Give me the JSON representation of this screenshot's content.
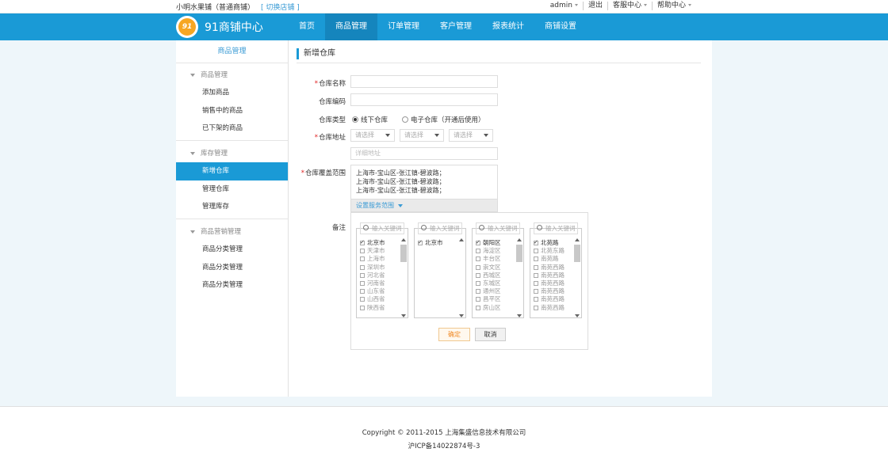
{
  "topbar": {
    "store_name": "小明水果铺（普通商铺）",
    "switch_store": "[ 切换店铺 ]",
    "user": "admin",
    "logout": "退出",
    "service_center": "客服中心",
    "help_center": "帮助中心"
  },
  "header": {
    "logo_text": "91",
    "brand": "91商铺中心",
    "nav": [
      "首页",
      "商品管理",
      "订单管理",
      "客户管理",
      "报表统计",
      "商铺设置"
    ],
    "active_nav": "商品管理"
  },
  "sidebar": {
    "title": "商品管理",
    "groups": [
      {
        "label": "商品管理",
        "items": [
          "添加商品",
          "销售中的商品",
          "已下架的商品"
        ]
      },
      {
        "label": "库存管理",
        "items": [
          "新增仓库",
          "管理仓库",
          "管理库存"
        ]
      },
      {
        "label": "商品营销管理",
        "items": [
          "商品分类管理",
          "商品分类管理",
          "商品分类管理"
        ]
      }
    ],
    "active_item": "新增仓库"
  },
  "form": {
    "title": "新增仓库",
    "required_mark": "*",
    "name_label": "仓库名称",
    "code_label": "仓库编码",
    "type_label": "仓库类型",
    "type_offline": "线下仓库",
    "type_online": "电子仓库（开通后使用）",
    "type_selected": "线下仓库",
    "address_label": "仓库地址",
    "select_placeholder": "请选择",
    "detail_placeholder": "详细地址",
    "coverage_label": "仓库覆盖范围",
    "coverage_lines": [
      "上海市-宝山区-张江镇-碧波路；",
      "上海市-宝山区-张江镇-碧波路；",
      "上海市-宝山区-张江镇-碧波路；"
    ],
    "set_range": "设置服务范围",
    "remark_label": "备注",
    "search_placeholder": "输入关键词",
    "columns": [
      {
        "items": [
          "北京市",
          "天津市",
          "上海市",
          "深圳市",
          "河北省",
          "河南省",
          "山东省",
          "山西省",
          "陕西省"
        ],
        "checked": [
          0
        ],
        "scrollbar": true
      },
      {
        "items": [
          "北京市"
        ],
        "checked": [
          0
        ],
        "scrollbar": false
      },
      {
        "items": [
          "朝阳区",
          "海淀区",
          "丰台区",
          "崇文区",
          "西城区",
          "东城区",
          "通州区",
          "昌平区",
          "房山区"
        ],
        "checked": [
          0
        ],
        "scrollbar": true
      },
      {
        "items": [
          "北苑路",
          "北苑东路",
          "南苑路",
          "南苑西路",
          "南苑西路",
          "南苑西路",
          "南苑西路",
          "南苑西路",
          "南苑西路"
        ],
        "checked": [
          0
        ],
        "scrollbar": true
      }
    ],
    "ok_button": "确定",
    "cancel_button": "取消"
  },
  "footer": {
    "copyright": "Copyright © 2011-2015 上海集盛信息技术有限公司",
    "icp": "沪ICP备14022874号-3"
  },
  "colors": {
    "primary": "#1a9ad6",
    "primary_dark": "#1585bd",
    "required": "#e02020",
    "link": "#3a9bd5",
    "ok_text": "#f08c2a"
  }
}
